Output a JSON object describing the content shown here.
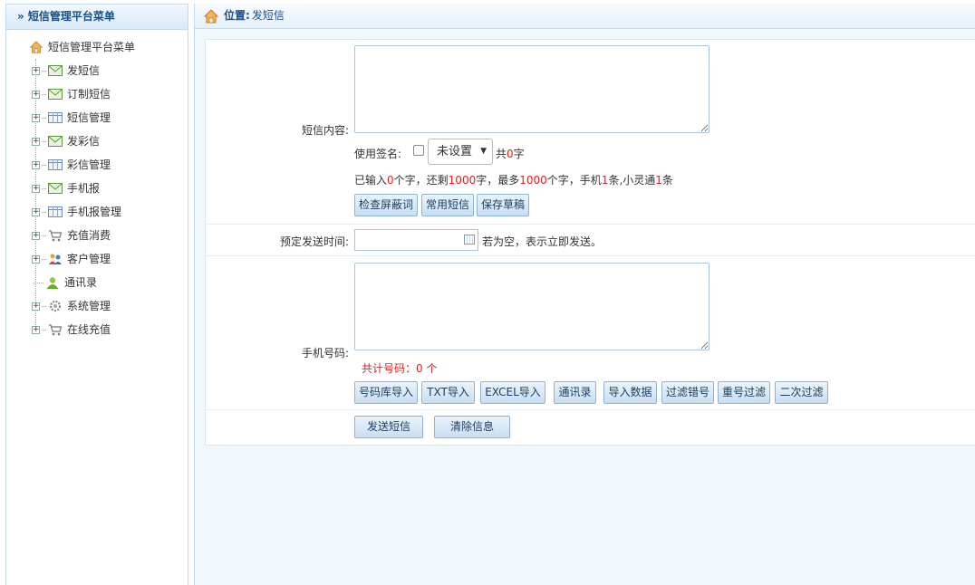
{
  "sidebar": {
    "title": "» 短信管理平台菜单",
    "root_label": "短信管理平台菜单",
    "items": [
      {
        "label": "发短信",
        "icon": "envelope-icon",
        "expandable": true
      },
      {
        "label": "订制短信",
        "icon": "envelope-icon",
        "expandable": true
      },
      {
        "label": "短信管理",
        "icon": "table-icon",
        "expandable": true
      },
      {
        "label": "发彩信",
        "icon": "envelope-icon",
        "expandable": true
      },
      {
        "label": "彩信管理",
        "icon": "table-icon",
        "expandable": true
      },
      {
        "label": "手机报",
        "icon": "envelope-icon",
        "expandable": true
      },
      {
        "label": "手机报管理",
        "icon": "table-icon",
        "expandable": true
      },
      {
        "label": "充值消费",
        "icon": "cart-icon",
        "expandable": true
      },
      {
        "label": "客户管理",
        "icon": "users-icon",
        "expandable": true
      },
      {
        "label": "通讯录",
        "icon": "user-icon",
        "expandable": false
      },
      {
        "label": "系统管理",
        "icon": "gear-icon",
        "expandable": true
      },
      {
        "label": "在线充值",
        "icon": "cart-icon",
        "expandable": true
      }
    ]
  },
  "header": {
    "position_label": "位置:",
    "position_value": "发短信"
  },
  "form": {
    "content_label": "短信内容:",
    "signature_label": "使用签名:",
    "signature_value": "未设置",
    "total_prefix": "共",
    "total_count": "0",
    "total_suffix": "字",
    "stats": {
      "p1": "已输入",
      "entered": "0",
      "p2": "个字，还剩",
      "remaining": "1000",
      "p3": "字，最多",
      "max": "1000",
      "p4": "个字，手机",
      "mobile": "1",
      "p5": "条,小灵通",
      "phs": "1",
      "p6": "条"
    },
    "content_buttons": [
      "检查屏蔽词",
      "常用短信",
      "保存草稿"
    ],
    "schedule_label": "预定发送时间:",
    "schedule_hint": "若为空，表示立即发送。",
    "phone_label": "手机号码:",
    "phone_count_text": "共计号码：0 个",
    "phone_buttons": [
      "号码库导入",
      "TXT导入",
      "EXCEL导入",
      "通讯录",
      "导入数据",
      "过滤错号",
      "重号过滤",
      "二次过滤"
    ],
    "send_button": "发送短信",
    "clear_button": "清除信息"
  },
  "colors": {
    "accent": "#1b4f8a",
    "highlight_red": "#e02020",
    "main_bg": "#f0f8fd"
  }
}
